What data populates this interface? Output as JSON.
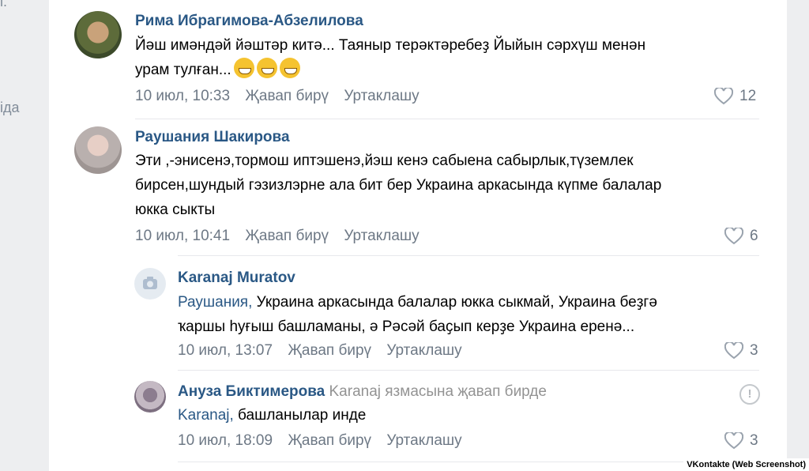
{
  "left_fragments": {
    "top": "l.",
    "mid": "іда"
  },
  "comments": [
    {
      "author": "Рима Ибрагимова-Абзелилова",
      "line1": "Йәш имәндәй йәштәр китә... Таяныр терәктәребеҙ Йыйын сәрхүш менән",
      "line2": "урам тулған...",
      "date": "10 июл, 10:33",
      "reply_label": "Җавап бирү",
      "share_label": "Уртаклашу",
      "likes": "12"
    },
    {
      "author": "Раушания Шакирова",
      "line1": "Эти ,-энисенэ,тормош иптэшенэ,йэш кенэ сабыена сабырлык,түземлек",
      "line2": "бирсен,шундый гэзизлэрне ала бит бер Украина аркасында күпме балалар",
      "line3": "юкка сыкты",
      "date": "10 июл, 10:41",
      "reply_label": "Җавап бирү",
      "share_label": "Уртаклашу",
      "likes": "6"
    },
    {
      "author": "Karanaj Muratov",
      "mention": "Раушания,",
      "line1_rest": " Украина аркасында балалар юкка сыкмай, Украина беҙгә",
      "line2": "ҡаршы һуғыш башламаны, ә Рәсәй баҫып керҙе Украина еренә...",
      "date": "10 июл, 13:07",
      "reply_label": "Җавап бирү",
      "share_label": "Уртаклашу",
      "likes": "3"
    },
    {
      "author": "Ануза Биктимерова",
      "reply_note": "Karanaj язмасына җавап бирде",
      "mention": "Karanaj,",
      "line1_rest": " башланылар инде",
      "date": "10 июл, 18:09",
      "reply_label": "Җавап бирү",
      "share_label": "Уртаклашу",
      "likes": "3"
    }
  ],
  "watermark": "VKontakte (Web Screenshot)",
  "colors": {
    "author": "#2a5885",
    "meta": "#6d7885",
    "background": "#edeef0"
  }
}
